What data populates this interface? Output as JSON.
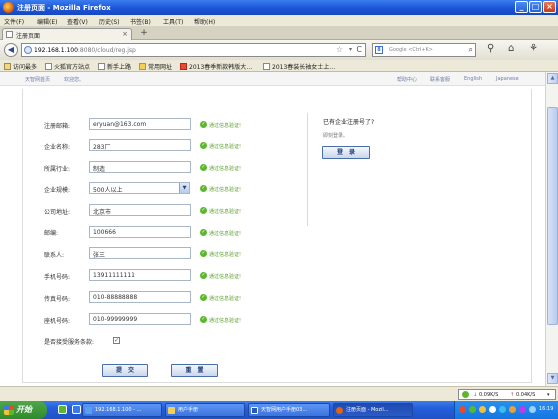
{
  "window": {
    "title": "注册页面 - Mozilla Firefox"
  },
  "menu": [
    "文件(F)",
    "编辑(E)",
    "查看(V)",
    "历史(S)",
    "书签(B)",
    "工具(T)",
    "帮助(H)"
  ],
  "tab": {
    "title": "注册页面",
    "close": "×",
    "new_tab": "+"
  },
  "nav": {
    "url_host": "192.168.1.100",
    "url_path": ":8080/cloud/reg.jsp",
    "search_placeholder": "Google <Ctrl+K>"
  },
  "bookmarks": [
    "访问最多",
    "火狐官方站点",
    "新手上路",
    "常用网址",
    "2013春季新款韩版大…",
    "2013春装长袖女士上…"
  ],
  "page_header": {
    "left": [
      "天智网首页",
      "欢迎您。"
    ],
    "right": [
      "帮助中心",
      "联系客服",
      "English",
      "Japanese"
    ]
  },
  "form": {
    "fields": [
      {
        "label": "注册邮箱:",
        "value": "eryuan@163.com",
        "ok": "通过信息验证!"
      },
      {
        "label": "企业名称:",
        "value": "283厂",
        "ok": "通过信息验证!"
      },
      {
        "label": "所属行业:",
        "value": "制造",
        "ok": "通过信息验证!"
      },
      {
        "label": "企业规模:",
        "value": "500人以上",
        "ok": "通过信息验证!"
      },
      {
        "label": "公司地址:",
        "value": "北京市",
        "ok": "通过信息验证!"
      },
      {
        "label": "邮编:",
        "value": "100666",
        "ok": "通过信息验证!"
      },
      {
        "label": "联系人:",
        "value": "张三",
        "ok": "通过信息验证!"
      },
      {
        "label": "手机号码:",
        "value": "13911111111",
        "ok": "通过信息验证!"
      },
      {
        "label": "传真号码:",
        "value": "010-88888888",
        "ok": "通过信息验证!"
      },
      {
        "label": "座机号码:",
        "value": "010-99999999",
        "ok": "通过信息验证!"
      }
    ],
    "agree_label": "是否接受服务条款:",
    "agree_checked": true,
    "submit_label": "提　交",
    "reset_label": "重　置"
  },
  "right_panel": {
    "title": "已有企业注册号了?",
    "subtitle": "即刻登录。",
    "login_label": "登　录"
  },
  "status": {
    "down": "0.09K/S",
    "up": "0.04K/S"
  },
  "taskbar": {
    "start": "开始",
    "items": [
      "192.168.1.100 - ...",
      "用户手册",
      "天智网用户手册03...",
      "注册页面 - Mozil..."
    ],
    "clock": "16:19"
  }
}
